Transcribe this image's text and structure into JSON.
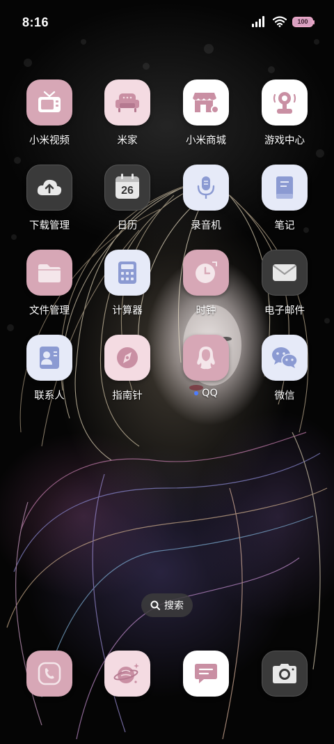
{
  "status_bar": {
    "time": "8:16",
    "battery_level": "100",
    "signal_icon": "signal-bars-icon",
    "wifi_icon": "wifi-icon"
  },
  "apps": [
    {
      "label": "小米视频",
      "icon": "tv-icon",
      "bg": "#d7a7b6"
    },
    {
      "label": "米家",
      "icon": "sofa-icon",
      "bg": "#f4dbe2"
    },
    {
      "label": "小米商城",
      "icon": "shop-icon",
      "bg": "#ffffff"
    },
    {
      "label": "游戏中心",
      "icon": "joystick-icon",
      "bg": "#ffffff"
    },
    {
      "label": "下载管理",
      "icon": "cloud-download-icon",
      "bg": "#3a3a3a"
    },
    {
      "label": "日历",
      "icon": "calendar-icon",
      "bg": "#3a3a3a",
      "day": "26"
    },
    {
      "label": "录音机",
      "icon": "microphone-icon",
      "bg": "#e6eaf8"
    },
    {
      "label": "笔记",
      "icon": "notebook-icon",
      "bg": "#e6eaf8"
    },
    {
      "label": "文件管理",
      "icon": "folder-icon",
      "bg": "#d7a7b6"
    },
    {
      "label": "计算器",
      "icon": "calculator-icon",
      "bg": "#e6eaf8"
    },
    {
      "label": "时钟",
      "icon": "clock-icon",
      "bg": "#d7a7b6"
    },
    {
      "label": "电子邮件",
      "icon": "mail-icon",
      "bg": "#3a3a3a"
    },
    {
      "label": "联系人",
      "icon": "contact-card-icon",
      "bg": "#e6eaf8"
    },
    {
      "label": "指南针",
      "icon": "compass-icon",
      "bg": "#f4dbe2"
    },
    {
      "label": "QQ",
      "icon": "qq-icon",
      "bg": "#d7a7b6",
      "badge": true
    },
    {
      "label": "微信",
      "icon": "wechat-icon",
      "bg": "#e6eaf8"
    }
  ],
  "search": {
    "label": "搜索",
    "icon": "search-icon"
  },
  "dock": [
    {
      "icon": "phone-icon",
      "bg": "#d7a7b6"
    },
    {
      "icon": "browser-planet-icon",
      "bg": "#f4dbe2"
    },
    {
      "icon": "message-icon",
      "bg": "#ffffff"
    },
    {
      "icon": "camera-icon",
      "bg": "#3a3a3a"
    }
  ]
}
